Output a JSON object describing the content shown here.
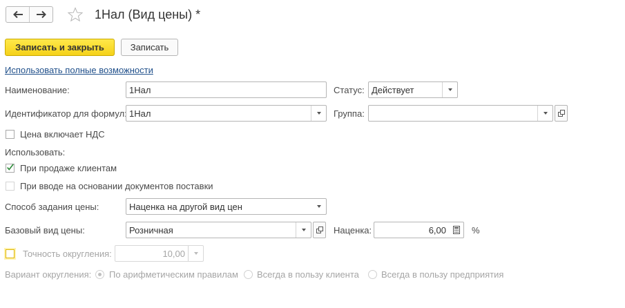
{
  "header": {
    "title": "1Нал (Вид цены) *",
    "back_icon": "arrow-left-icon",
    "forward_icon": "arrow-right-icon",
    "favorite_icon": "star-icon"
  },
  "toolbar": {
    "save_close_label": "Записать и закрыть",
    "save_label": "Записать"
  },
  "full_features_link": "Использовать полные возможности",
  "form": {
    "name": {
      "label": "Наименование:",
      "value": "1Нал"
    },
    "status": {
      "label": "Статус:",
      "value": "Действует"
    },
    "formula_id": {
      "label": "Идентификатор для формул:",
      "value": "1Нал"
    },
    "group": {
      "label": "Группа:",
      "value": ""
    },
    "vat_included": {
      "label": "Цена включает НДС",
      "checked": false
    },
    "use_label": "Использовать:",
    "on_sale": {
      "label": "При продаже клиентам",
      "checked": true
    },
    "on_supply_docs": {
      "label": "При вводе на основании документов поставки",
      "checked": false,
      "disabled": true
    },
    "price_method": {
      "label": "Способ задания цены:",
      "value": "Наценка на другой вид цен"
    },
    "base_price_type": {
      "label": "Базовый вид цены:",
      "value": "Розничная"
    },
    "markup": {
      "label": "Наценка:",
      "value": "6,00",
      "unit": "%"
    },
    "rounding_precision": {
      "label": "Точность округления:",
      "value": "10,00",
      "checked": false
    },
    "rounding_variant": {
      "label": "Вариант округления:",
      "options": [
        "По арифметическим правилам",
        "Всегда в пользу клиента",
        "Всегда в пользу предприятия"
      ],
      "selected": 0
    }
  },
  "colors": {
    "primary_button": "#f5d21a",
    "link": "#1f4f8a",
    "check": "#2e8b3a"
  }
}
